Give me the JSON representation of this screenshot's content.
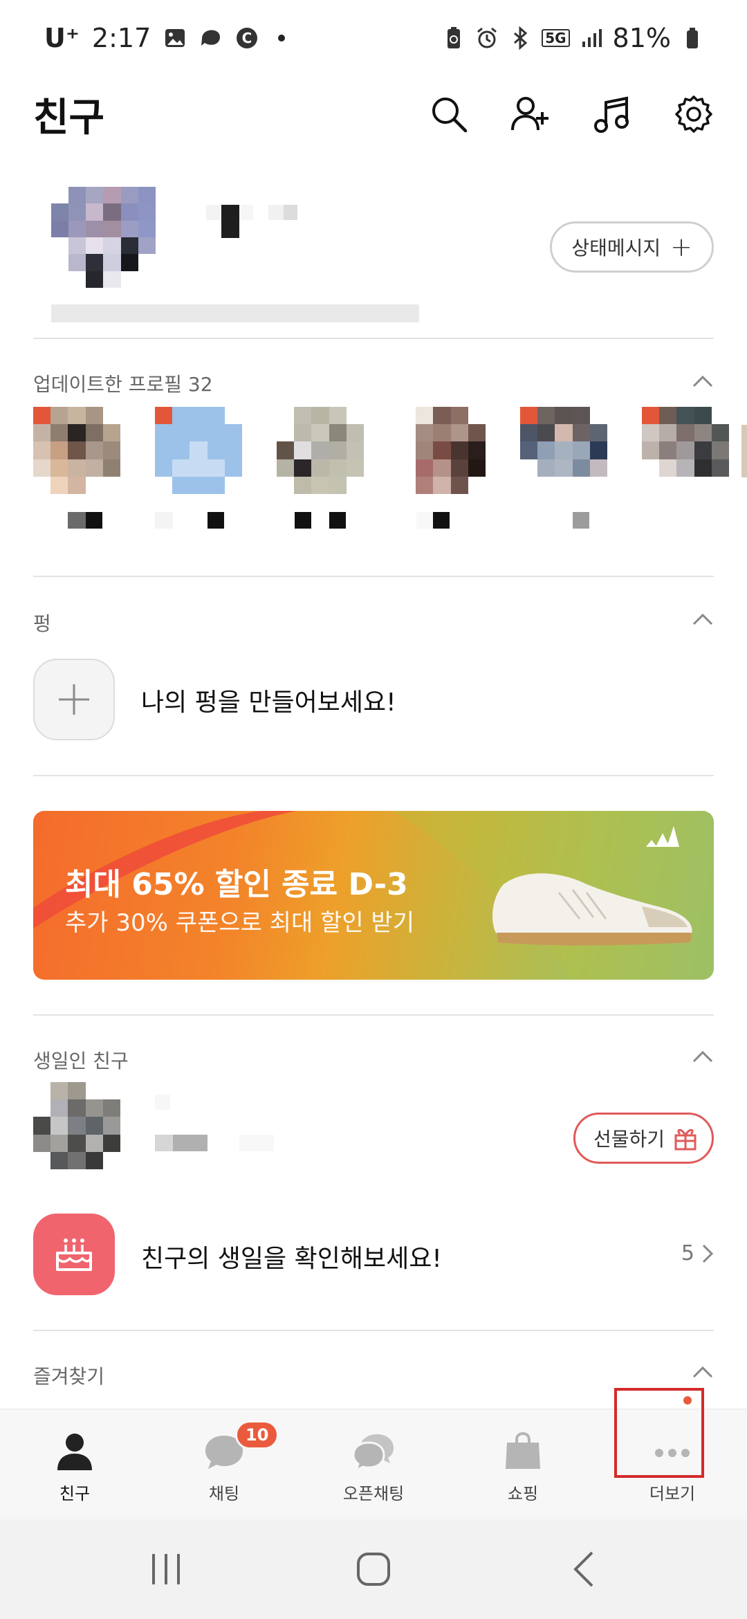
{
  "status_bar": {
    "carrier": "U⁺",
    "time": "2:17",
    "network": "5G",
    "battery": "81%"
  },
  "header": {
    "title": "친구"
  },
  "profile": {
    "status_button": "상태메시지"
  },
  "updated_profiles": {
    "title": "업데이트한 프로필 32"
  },
  "pyeong": {
    "title": "펑",
    "prompt": "나의 펑을 만들어보세요!"
  },
  "banner": {
    "headline": "최대 65% 할인 종료 D-3",
    "subline": "추가 30% 쿠폰으로 최대 할인 받기",
    "brand_icon": "adidas-logo"
  },
  "birthday": {
    "title": "생일인 친구",
    "gift_button": "선물하기",
    "check_prompt": "친구의 생일을 확인해보세요!",
    "count": "5"
  },
  "favorites": {
    "title": "즐겨찾기"
  },
  "bottom_nav": {
    "items": [
      {
        "label": "친구",
        "icon": "person-icon"
      },
      {
        "label": "채팅",
        "icon": "chat-bubble-icon",
        "badge": "10"
      },
      {
        "label": "오픈채팅",
        "icon": "open-chat-icon"
      },
      {
        "label": "쇼핑",
        "icon": "shopping-bag-icon"
      },
      {
        "label": "더보기",
        "icon": "more-dots-icon"
      }
    ]
  },
  "colors": {
    "accent_red": "#ea5a3c",
    "highlight_box": "#d42a2a",
    "birthday_pink": "#f0646e"
  }
}
